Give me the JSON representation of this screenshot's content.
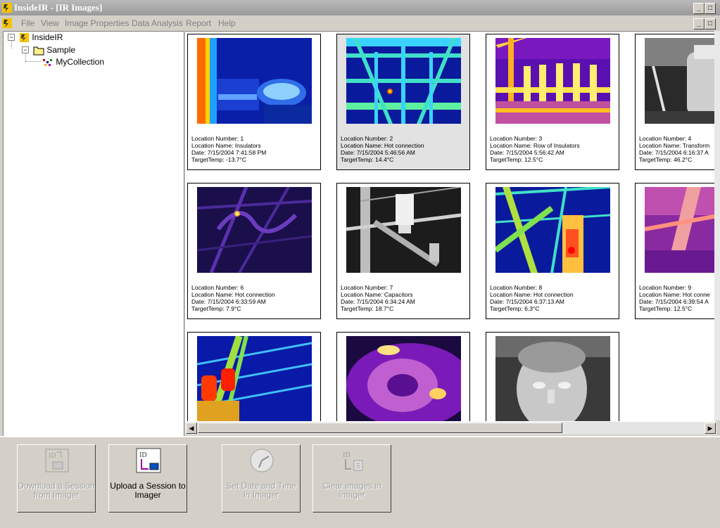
{
  "window": {
    "title": "InsideIR - [IR Images]"
  },
  "menu": [
    "File",
    "View",
    "Image Properties",
    "Data Analysis",
    "Report",
    "Help"
  ],
  "tree": {
    "root": "InsideIR",
    "folder": "Sample",
    "collection": "MyCollection"
  },
  "field_labels": {
    "number": "Location Number: ",
    "name": "Location Name: ",
    "date": "Date: ",
    "temp": "TargetTemp: "
  },
  "images": [
    {
      "number": "1",
      "name": "Insulators",
      "date": "7/15/2004 7:41:58 PM",
      "temp": "-13.7°C"
    },
    {
      "number": "2",
      "name": "Hot connection",
      "date": "7/15/2004 5:46:56 AM",
      "temp": "14.4°C"
    },
    {
      "number": "3",
      "name": "Row of Insulators",
      "date": "7/15/2004 5:56:42 AM",
      "temp": "12.5°C"
    },
    {
      "number": "4",
      "name": "Transform",
      "date": "7/15/2004 6:16:37 A",
      "temp": "46.2°C"
    },
    {
      "number": "6",
      "name": "Hot connection",
      "date": "7/15/2004 6:33:59 AM",
      "temp": "7.9°C"
    },
    {
      "number": "7",
      "name": "Capacitors",
      "date": "7/15/2004 6:34:24 AM",
      "temp": "18.7°C"
    },
    {
      "number": "8",
      "name": "Hot connection",
      "date": "7/15/2004 6:37:13 AM",
      "temp": "6.3°C"
    },
    {
      "number": "9",
      "name": "Hot conne",
      "date": "7/15/2004 6:39:54 A",
      "temp": "12.5°C"
    }
  ],
  "buttons": {
    "download": "Download a Session from Imager",
    "upload": "Upload a Session to Imager",
    "set_date": "Set Date and Time in Imager",
    "clear": "Clear images in Imager"
  }
}
